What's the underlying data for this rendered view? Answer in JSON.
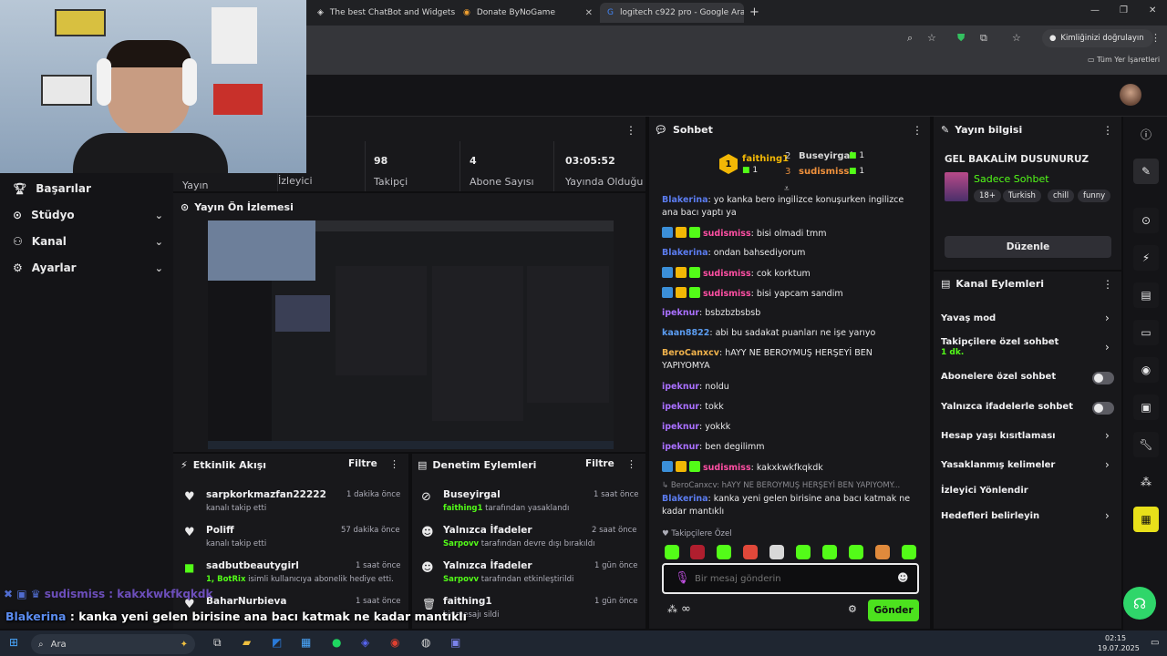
{
  "browser": {
    "tabs": [
      {
        "label": "The best ChatBot and Widgets"
      },
      {
        "label": "Donate ByNoGame"
      },
      {
        "label": "logitech c922 pro - Google Ara"
      }
    ],
    "verify_label": "Kimliğinizi doğrulayın",
    "bookmarks_label": "Tüm Yer İşaretleri"
  },
  "nav": {
    "items": [
      {
        "label": "Başarılar"
      },
      {
        "label": "Stüdyo"
      },
      {
        "label": "Kanal"
      },
      {
        "label": "Ayarlar"
      }
    ]
  },
  "stats": {
    "cells": [
      {
        "value": "",
        "label": "Yayın"
      },
      {
        "value": "",
        "label": "İzleyici"
      },
      {
        "value": "98",
        "label": "Takipçi"
      },
      {
        "value": "4",
        "label": "Abone Sayısı"
      },
      {
        "value": "03:05:52",
        "label": "Yayında Olduğu"
      }
    ]
  },
  "preview": {
    "title": "Yayın Ön İzlemesi"
  },
  "activity": {
    "title": "Etkinlik Akışı",
    "filter": "Filtre",
    "items": [
      {
        "name": "sarpkorkmazfan22222",
        "sub": "kanalı takip etti",
        "time": "1 dakika önce"
      },
      {
        "name": "Poliff",
        "sub": "kanalı takip etti",
        "time": "57 dakika önce"
      },
      {
        "name": "sadbutbeautygirl",
        "sub_user": "1, BotRix",
        "sub": "isimli kullanıcıya abonelik hediye etti.",
        "time": "1 saat önce"
      },
      {
        "name": "BaharNurbieva",
        "sub": "",
        "time": "1 saat önce"
      }
    ]
  },
  "moderation": {
    "title": "Denetim Eylemleri",
    "filter": "Filtre",
    "items": [
      {
        "title": "Buseyirgal",
        "actor": "faithing1",
        "sub": "tarafından yasaklandı",
        "time": "1 saat önce"
      },
      {
        "title": "Yalnızca İfadeler",
        "actor": "Sarpovv",
        "sub": "tarafından devre dışı bırakıldı",
        "time": "2 saat önce"
      },
      {
        "title": "Yalnızca İfadeler",
        "actor": "Sarpovv",
        "sub": "tarafından etkinleştirildi",
        "time": "1 gün önce"
      },
      {
        "title": "faithing1",
        "actor": "",
        "sub": "bir mesajı sildi",
        "time": "1 gün önce"
      }
    ]
  },
  "chat": {
    "title": "Sohbet",
    "leaders": [
      {
        "rank": "1",
        "name": "faithing1",
        "count": "1"
      },
      {
        "rank": "2",
        "name": "Buseyirgal",
        "count": "1"
      },
      {
        "rank": "3",
        "name": "sudismiss",
        "count": "1"
      }
    ],
    "messages": [
      {
        "user": "Blakerina",
        "color": "#5b7cf0",
        "badges": 0,
        "text": ": yo kanka bero ingilizce konuşurken ingilizce ana bacı yaptı ya"
      },
      {
        "user": "sudismiss",
        "color": "#ff4fa3",
        "badges": 3,
        "text": ": bisi olmadi tmm"
      },
      {
        "user": "Blakerina",
        "color": "#5b7cf0",
        "badges": 0,
        "text": ": ondan bahsediyorum"
      },
      {
        "user": "sudismiss",
        "color": "#ff4fa3",
        "badges": 3,
        "text": ": cok korktum"
      },
      {
        "user": "sudismiss",
        "color": "#ff4fa3",
        "badges": 3,
        "text": ": bisi yapcam sandim"
      },
      {
        "user": "ipeknur",
        "color": "#a970ff",
        "badges": 0,
        "text": ": bsbzbzbsbsb"
      },
      {
        "user": "kaan8822",
        "color": "#5b9cf0",
        "badges": 0,
        "text": ": abi bu sadakat puanları ne işe yarıyo"
      },
      {
        "user": "BeroCanxcv",
        "color": "#f0b24c",
        "badges": 0,
        "text": ": hAYY NE BEROYMUŞ HERŞEYİ BEN YAPIYOMYA"
      },
      {
        "user": "ipeknur",
        "color": "#a970ff",
        "badges": 0,
        "text": ": noldu"
      },
      {
        "user": "ipeknur",
        "color": "#a970ff",
        "badges": 0,
        "text": ": tokk"
      },
      {
        "user": "ipeknur",
        "color": "#a970ff",
        "badges": 0,
        "text": ": yokkk"
      },
      {
        "user": "ipeknur",
        "color": "#a970ff",
        "badges": 0,
        "text": ": ben degilimm"
      },
      {
        "user": "sudismiss",
        "color": "#ff4fa3",
        "badges": 3,
        "text": ": kakxkwkfkqkdk"
      }
    ],
    "reply_preview": "BeroCanxcv: hAYY NE BEROYMUŞ HERŞEYİ BEN YAPIYOMY...",
    "reply": {
      "user": "Blakerina",
      "text": ": kanka yeni gelen birisine ana bacı katmak ne kadar mantıklı"
    },
    "followers_only": "Takipçilere Özel",
    "input_placeholder": "Bir mesaj gönderin",
    "send": "Gönder"
  },
  "info": {
    "title": "Yayın bilgisi",
    "stream_title": "GEL BAKALİM DUSUNURUZ",
    "category": "Sadece Sohbet",
    "tags": [
      "18+",
      "Turkish",
      "chill",
      "funny"
    ],
    "edit": "Düzenle"
  },
  "actions": {
    "title": "Kanal Eylemleri",
    "rows": [
      {
        "label": "Yavaş mod",
        "sub": "",
        "control": "chevron"
      },
      {
        "label": "Takipçilere özel sohbet",
        "sub": "1 dk.",
        "control": "chevron"
      },
      {
        "label": "Abonelere özel sohbet",
        "sub": "",
        "control": "toggle"
      },
      {
        "label": "Yalnızca ifadelerle sohbet",
        "sub": "",
        "control": "toggle"
      },
      {
        "label": "Hesap yaşı kısıtlaması",
        "sub": "",
        "control": "chevron"
      },
      {
        "label": "Yasaklanmış kelimeler",
        "sub": "",
        "control": "chevron"
      },
      {
        "label": "İzleyici Yönlendir",
        "sub": "",
        "control": "none"
      },
      {
        "label": "Hedefleri belirleyin",
        "sub": "",
        "control": "chevron"
      }
    ]
  },
  "overlay": {
    "line1": "sudismiss : kakxkwkfkqkdk",
    "line2_user": "Blakerina",
    "line2_text": " : kanka yeni gelen birisine ana bacı katmak ne kadar mantıklı"
  },
  "taskbar": {
    "search": "Ara",
    "time": "02:15",
    "date": "19.07.2025"
  },
  "colors": {
    "accent": "#53fc18",
    "send": "#4ce21e",
    "panel": "#18181b",
    "bg": "#0e0e10"
  }
}
